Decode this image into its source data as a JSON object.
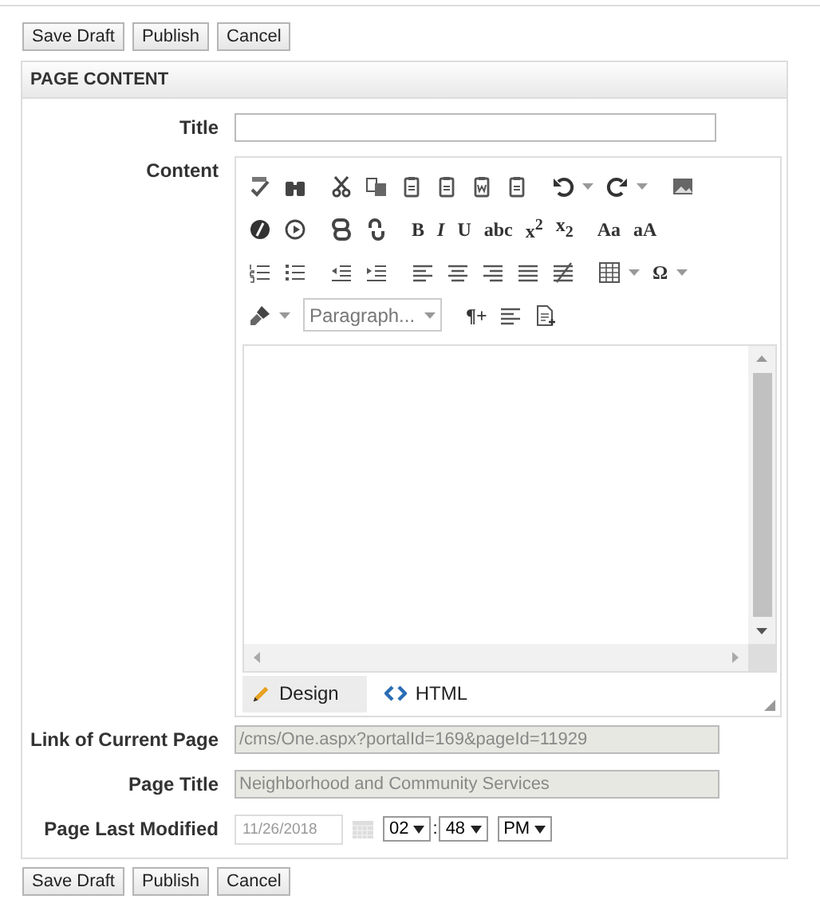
{
  "top_buttons": [
    "Save Draft",
    "Publish",
    "Cancel"
  ],
  "panel": {
    "title": "PAGE CONTENT",
    "title_field": {
      "label": "Title"
    },
    "content": {
      "label": "Content",
      "toolbar": [
        {
          "items": [
            {
              "kind": "spellcheck"
            },
            {
              "kind": "find"
            },
            {
              "kind": "cut",
              "gap_before": true
            },
            {
              "kind": "copy"
            },
            {
              "kind": "paste"
            },
            {
              "kind": "paste"
            },
            {
              "kind": "paste-word"
            },
            {
              "kind": "paste"
            },
            {
              "kind": "undo",
              "dropdown": true,
              "gap_before": true
            },
            {
              "kind": "redo",
              "dropdown": true
            },
            {
              "kind": "image",
              "gap_before": true
            }
          ]
        },
        {
          "items": [
            {
              "kind": "disc"
            },
            {
              "kind": "play"
            },
            {
              "kind": "link",
              "gap_before": true
            },
            {
              "kind": "unlink"
            },
            {
              "kind": "glyph",
              "label": "B",
              "gap_before": true
            },
            {
              "kind": "glyph",
              "label": "*I*"
            },
            {
              "kind": "glyph",
              "label": "U"
            },
            {
              "kind": "glyph",
              "label": "abc"
            },
            {
              "kind": "glyph",
              "label": "x$^{2}$"
            },
            {
              "kind": "glyph",
              "label": "x$_{2}$"
            },
            {
              "kind": "glyph",
              "label": "Aa",
              "gap_before": true
            },
            {
              "kind": "glyph",
              "label": "aA"
            }
          ]
        },
        {
          "items": [
            {
              "kind": "ordered-list"
            },
            {
              "kind": "bullet-list"
            },
            {
              "kind": "outdent",
              "gap_before": true
            },
            {
              "kind": "indent"
            },
            {
              "kind": "align-left",
              "gap_before": true
            },
            {
              "kind": "align-center"
            },
            {
              "kind": "align-right"
            },
            {
              "kind": "justify"
            },
            {
              "kind": "no-align"
            },
            {
              "kind": "table",
              "dropdown": true,
              "gap_before": true
            },
            {
              "kind": "glyph",
              "label": "Ω",
              "dropdown": true
            }
          ]
        },
        {
          "items": [
            {
              "kind": "brush",
              "dropdown": true
            },
            {
              "kind": "select",
              "label": "Paragraph..."
            },
            {
              "kind": "glyph",
              "label": "¶+",
              "gap_before": true
            },
            {
              "kind": "align-left"
            },
            {
              "kind": "new-doc"
            }
          ]
        }
      ],
      "modes": [
        {
          "label": "Design",
          "kind": "design",
          "selected": true
        },
        {
          "label": "HTML",
          "kind": "html",
          "selected": false
        }
      ]
    },
    "fields": [
      {
        "label": "Link of Current Page",
        "kind": "readonly",
        "value": "/cms/One.aspx?portalId=169&pageId=11929"
      },
      {
        "label": "Page Title",
        "kind": "readonly",
        "value": "Neighborhood and Community Services"
      },
      {
        "label": "Page Last Modified",
        "kind": "datetime",
        "date": "11/26/2018",
        "hour": "02",
        "separator": ":",
        "minute": "48",
        "ampm": "PM"
      }
    ]
  },
  "bottom_buttons": [
    "Save Draft",
    "Publish",
    "Cancel"
  ]
}
